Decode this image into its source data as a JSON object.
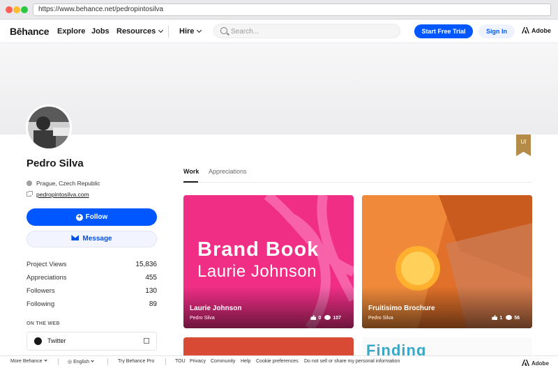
{
  "browser": {
    "url": "https://www.behance.net/pedropintosilva"
  },
  "header": {
    "logo": "Bēhance",
    "nav": [
      "Explore",
      "Jobs",
      "Resources",
      "Hire"
    ],
    "search_placeholder": "Search...",
    "trial_label": "Start Free Trial",
    "signin_label": "Sign In",
    "adobe_label": "Adobe"
  },
  "ribbon": "UI",
  "profile": {
    "name": "Pedro Silva",
    "location": "Prague, Czech Republic",
    "website": "pedropintosilva.com",
    "follow_label": "Follow",
    "message_label": "Message",
    "stats": [
      {
        "label": "Project Views",
        "value": "15,836"
      },
      {
        "label": "Appreciations",
        "value": "455"
      },
      {
        "label": "Followers",
        "value": "130"
      },
      {
        "label": "Following",
        "value": "89"
      }
    ],
    "on_the_web_label": "ON THE WEB",
    "social": {
      "label": "Twitter"
    }
  },
  "tabs": [
    "Work",
    "Appreciations"
  ],
  "projects": [
    {
      "title": "Laurie Johnson",
      "owner": "Pedro Silva",
      "likes": "0",
      "views": "107",
      "cover_title": "Brand Book",
      "cover_subtitle": "Laurie Johnson"
    },
    {
      "title": "Fruitisimo Brochure",
      "owner": "Pedro Silva",
      "likes": "1",
      "views": "56"
    }
  ],
  "partial_card_text": "Finding",
  "footer": {
    "more": "More Behance",
    "language": "English",
    "pro": "Try Behance Pro",
    "links": [
      "TOU",
      "Privacy",
      "Community",
      "Help",
      "Cookie preferences",
      "Do not sell or share my personal information"
    ],
    "adobe": "Adobe"
  },
  "colors": {
    "primary": "#0057ff",
    "card1": "#f02e86",
    "card2": "#e57b2d",
    "ribbon": "#b48b48"
  }
}
